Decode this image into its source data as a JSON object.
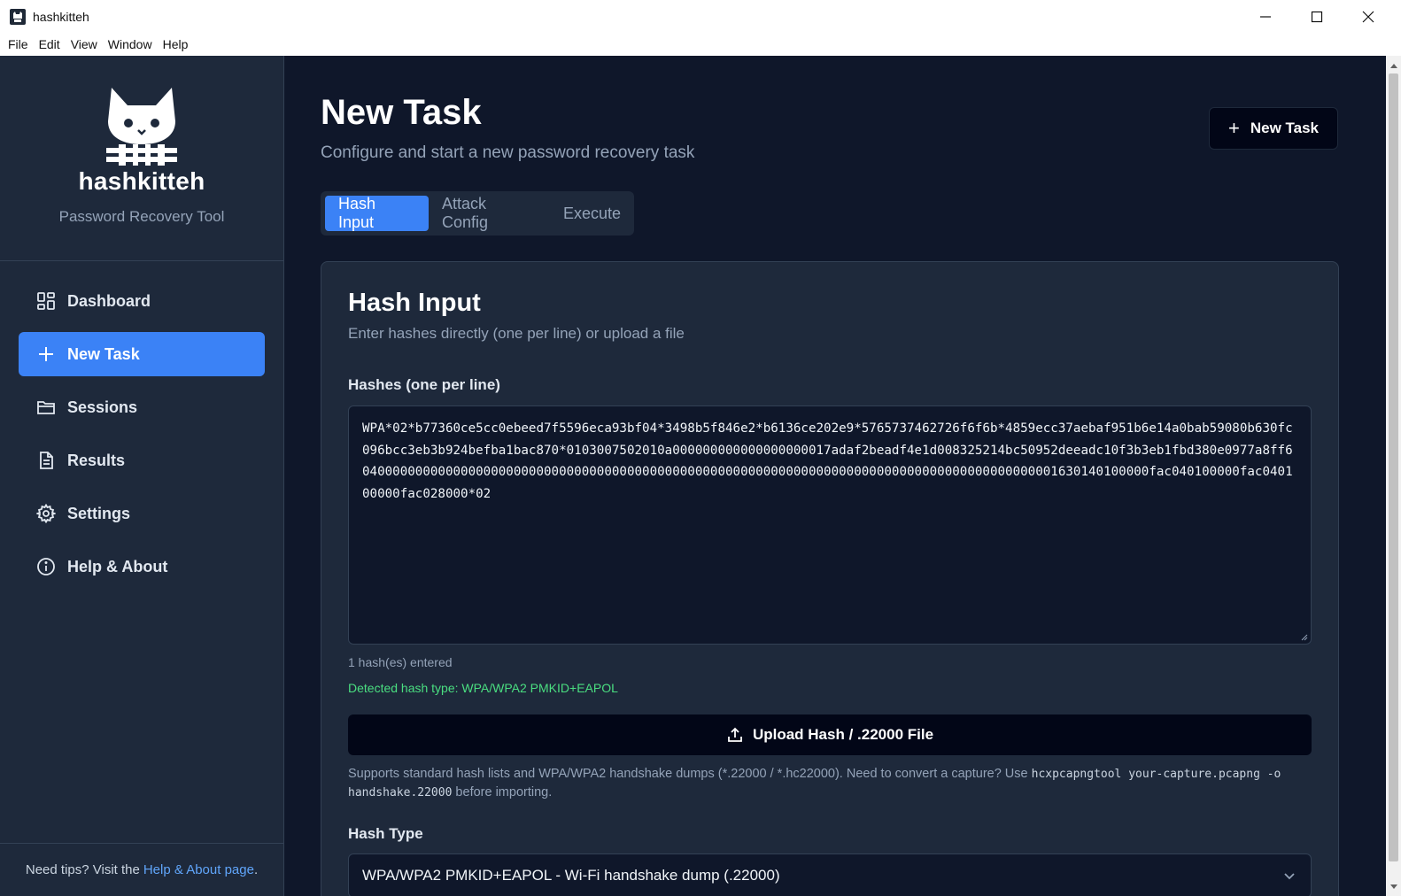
{
  "window": {
    "title": "hashkitteh"
  },
  "menu": [
    "File",
    "Edit",
    "View",
    "Window",
    "Help"
  ],
  "sidebar": {
    "brand_name": "hashkitteh",
    "brand_subtitle": "Password Recovery Tool",
    "items": [
      {
        "label": "Dashboard",
        "icon": "dashboard-icon"
      },
      {
        "label": "New Task",
        "icon": "plus-icon",
        "active": true
      },
      {
        "label": "Sessions",
        "icon": "folder-icon"
      },
      {
        "label": "Results",
        "icon": "file-icon"
      },
      {
        "label": "Settings",
        "icon": "gear-icon"
      },
      {
        "label": "Help & About",
        "icon": "info-icon"
      }
    ],
    "footer_text": "Need tips? Visit the",
    "footer_link": "Help & About page",
    "footer_end": "."
  },
  "main": {
    "title": "New Task",
    "subtitle": "Configure and start a new password recovery task",
    "new_task_button": "New Task",
    "tabs": [
      "Hash Input",
      "Attack Config",
      "Execute"
    ],
    "active_tab": "Hash Input"
  },
  "card": {
    "title": "Hash Input",
    "subtitle": "Enter hashes directly (one per line) or upload a file",
    "hashes_label": "Hashes (one per line)",
    "hashes_value": "WPA*02*b77360ce5cc0ebeed7f5596eca93bf04*3498b5f846e2*b6136ce202e9*5765737462726f6f6b*4859ecc37aebaf951b6e14a0bab59080b630fc096bcc3eb3b924befba1bac870*0103007502010a000000000000000000017adaf2beadf4e1d008325214bc50952deeadc10f3b3eb1fbd380e0977a8ff604000000000000000000000000000000000000000000000000000000000000000000000000000000000000000001630140100000fac040100000fac040100000fac028000*02",
    "hash_count": "1 hash(es) entered",
    "detected": "Detected hash type: WPA/WPA2 PMKID+EAPOL",
    "upload_button": "Upload Hash / .22000 File",
    "help_pre": "Supports standard hash lists and WPA/WPA2 handshake dumps (*.22000 / *.hc22000). Need to convert a capture? Use ",
    "help_code1": "hcxpcapngtool your-capture.pcapng -o handshake.22000",
    "help_post": " before importing.",
    "hash_type_label": "Hash Type",
    "hash_type_value": "WPA/WPA2 PMKID+EAPOL - Wi-Fi handshake dump (.22000)"
  },
  "colors": {
    "accent": "#3b82f6",
    "success": "#4ade80",
    "background": "#0f172a",
    "panel": "#1e293b"
  }
}
